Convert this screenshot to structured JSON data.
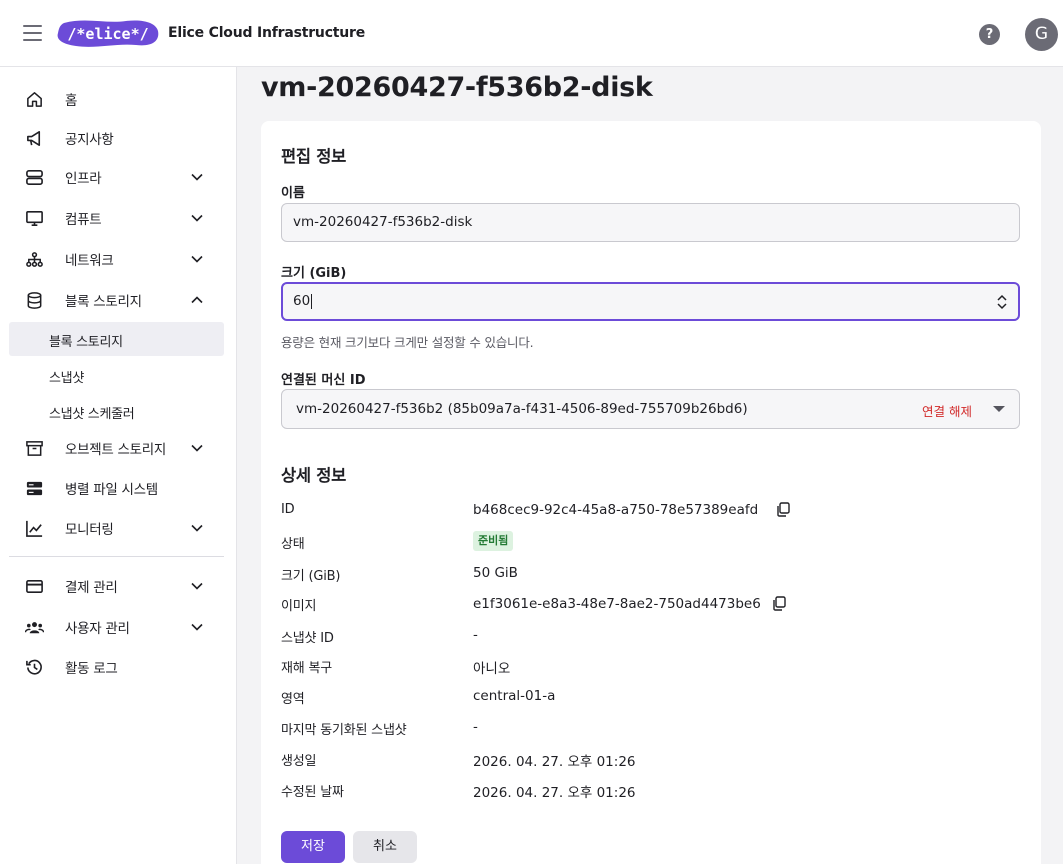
{
  "header": {
    "logo_text": "/*elice*/",
    "app_title": "Elice Cloud Infrastructure",
    "help_label": "?",
    "avatar_initial": "G"
  },
  "sidebar": {
    "items": [
      {
        "label": "홈",
        "icon": "home-icon"
      },
      {
        "label": "공지사항",
        "icon": "megaphone-icon"
      },
      {
        "label": "인프라",
        "icon": "server-icon"
      },
      {
        "label": "컴퓨트",
        "icon": "monitor-icon"
      },
      {
        "label": "네트워크",
        "icon": "network-icon"
      },
      {
        "label": "블록 스토리지",
        "icon": "database-icon"
      },
      {
        "label": "오브젝트 스토리지",
        "icon": "archive-icon"
      },
      {
        "label": "병렬 파일 시스템",
        "icon": "storage-icon"
      },
      {
        "label": "모니터링",
        "icon": "chart-icon"
      },
      {
        "label": "결제 관리",
        "icon": "credit-card-icon"
      },
      {
        "label": "사용자 관리",
        "icon": "users-icon"
      },
      {
        "label": "활동 로그",
        "icon": "history-icon"
      }
    ],
    "block_storage_sub": [
      {
        "label": "블록 스토리지",
        "active": true
      },
      {
        "label": "스냅샷",
        "active": false
      },
      {
        "label": "스냅샷 스케줄러",
        "active": false
      }
    ]
  },
  "main": {
    "page_title": "vm-20260427-f536b2-disk",
    "edit": {
      "section_title": "편집 정보",
      "name_label": "이름",
      "name_value": "vm-20260427-f536b2-disk",
      "size_label": "크기 (GiB)",
      "size_value": "60",
      "size_helper": "용량은 현재 크기보다 크게만 설정할 수 있습니다.",
      "machine_label": "연결된 머신 ID",
      "machine_value": "vm-20260427-f536b2 (85b09a7a-f431-4506-89ed-755709b26bd6)",
      "detach_label": "연결 해제"
    },
    "details": {
      "section_title": "상세 정보",
      "rows": [
        {
          "label": "ID",
          "value": "b468cec9-92c4-45a8-a750-78e57389eafd"
        },
        {
          "label": "상태",
          "value": "준비됨"
        },
        {
          "label": "크기 (GiB)",
          "value": "50 GiB"
        },
        {
          "label": "이미지",
          "value": "e1f3061e-e8a3-48e7-8ae2-750ad4473be6"
        },
        {
          "label": "스냅샷 ID",
          "value": "-"
        },
        {
          "label": "재해 복구",
          "value": "아니오"
        },
        {
          "label": "영역",
          "value": "central-01-a"
        },
        {
          "label": "마지막 동기화된 스냅샷",
          "value": "-"
        },
        {
          "label": "생성일",
          "value": "2026. 04. 27. 오후 01:26"
        },
        {
          "label": "수정된 날짜",
          "value": "2026. 04. 27. 오후 01:26"
        }
      ]
    },
    "actions": {
      "save_label": "저장",
      "cancel_label": "취소"
    }
  },
  "colors": {
    "accent": "#6c4bd8",
    "danger": "#d22a2a",
    "badge_bg": "#ddf2e0",
    "badge_text": "#237a34"
  }
}
